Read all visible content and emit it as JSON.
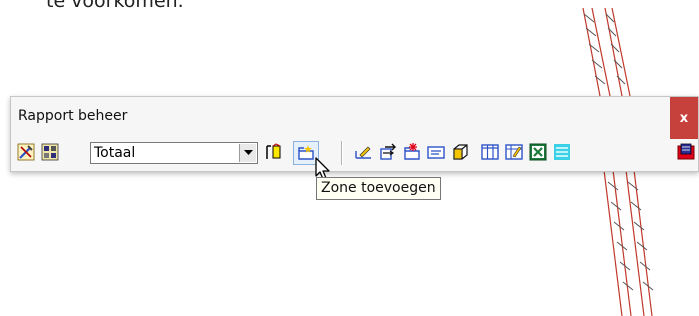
{
  "background": {
    "doc_text": "te voorkomen."
  },
  "window": {
    "title": "Rapport beheer",
    "close_label": "x"
  },
  "toolbar": {
    "combo_value": "Totaal",
    "icons": [
      "tools-icon",
      "report-grid-icon",
      "zone-bracket-icon",
      "add-zone-icon",
      "edit-zone-icon",
      "move-zone-icon",
      "delete-zone-icon",
      "zone-list-icon",
      "3d-box-icon",
      "table-columns-icon",
      "table-edit-icon",
      "excel-export-icon",
      "list-icon",
      "print-report-icon"
    ]
  },
  "tooltip": {
    "text": "Zone toevoegen"
  },
  "colors": {
    "close_bg": "#c6413c",
    "accent_blue": "#2d52c8",
    "drawing_red": "#c0392b"
  }
}
